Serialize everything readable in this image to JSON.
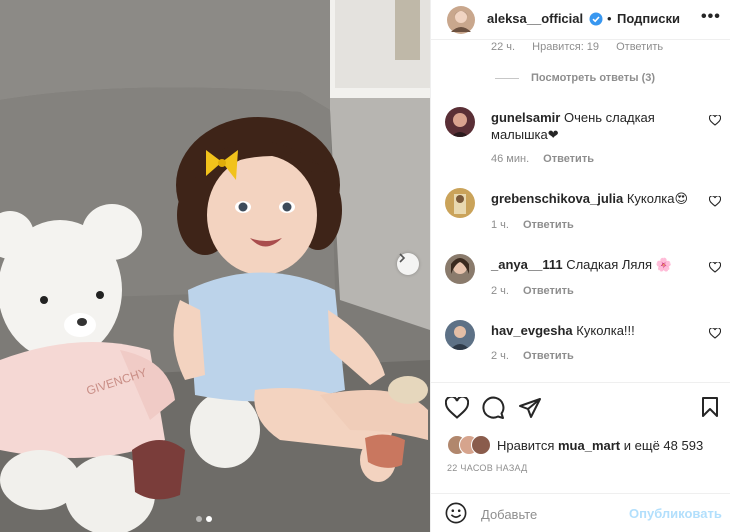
{
  "post": {
    "author": "aleksa__official",
    "separator": "•",
    "follow_label": "Подписки",
    "more_label": "•••"
  },
  "previous_comment": {
    "time": "22 ч.",
    "likes": "Нравится: 19",
    "reply_label": "Ответить",
    "view_replies": "Посмотреть ответы (3)"
  },
  "comments": [
    {
      "username": "gunelsamir",
      "text": "Очень сладкая малышка❤",
      "time": "46 мин.",
      "reply_label": "Ответить"
    },
    {
      "username": "grebenschikova_julia",
      "text": "Куколка😍",
      "time": "1 ч.",
      "reply_label": "Ответить"
    },
    {
      "username": "_anya__111",
      "text": "Сладкая Ляля 🌸",
      "time": "2 ч.",
      "reply_label": "Ответить"
    },
    {
      "username": "hav_evgesha",
      "text": "Куколка!!!",
      "time": "2 ч.",
      "reply_label": "Ответить"
    }
  ],
  "likes": {
    "prefix": "Нравится",
    "user": "mua_mart",
    "suffix": "и ещё 48 593"
  },
  "timestamp": "22 ЧАСОВ НАЗАД",
  "comment_box": {
    "placeholder": "Добавьте",
    "publish_label": "Опубликовать"
  },
  "icons": {
    "verified": "verified-badge-icon",
    "like": "heart-icon",
    "comment": "comment-icon",
    "share": "share-icon",
    "save": "bookmark-icon",
    "emoji": "smiley-icon",
    "next": "chevron-right-icon"
  },
  "colors": {
    "verified": "#3897f0",
    "publish_disabled": "#b2dffc",
    "secondary_text": "#8e8e8e"
  },
  "carousel": {
    "total_slides": 2,
    "active_slide": 2
  }
}
